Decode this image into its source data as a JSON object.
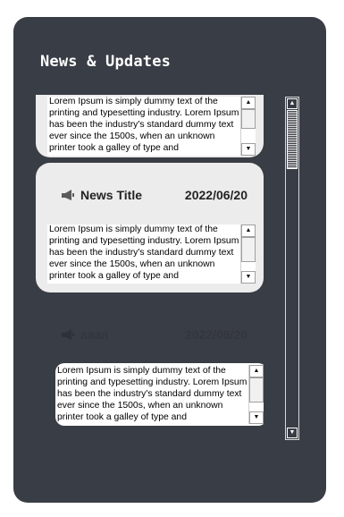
{
  "panel": {
    "title": "News & Updates"
  },
  "body_text": "Lorem Ipsum is simply dummy text of the printing and typesetting industry. Lorem Ipsum has been the industry's standard dummy text ever since the 1500s, when an unknown printer took a galley of type and",
  "news_items": [
    {
      "title": "",
      "date": ""
    },
    {
      "title": "News Title",
      "date": "2022/06/20"
    },
    {
      "title": "aaaa",
      "date": "2022/06/20"
    }
  ],
  "icons": {
    "item_icon": "megaphone-icon"
  },
  "scroll_arrows": {
    "up": "▲",
    "down": "▼"
  },
  "colors": {
    "panel_bg": "#393d45",
    "card_bg": "#ececec",
    "title_text": "#ffffff",
    "card_text": "#232323"
  }
}
